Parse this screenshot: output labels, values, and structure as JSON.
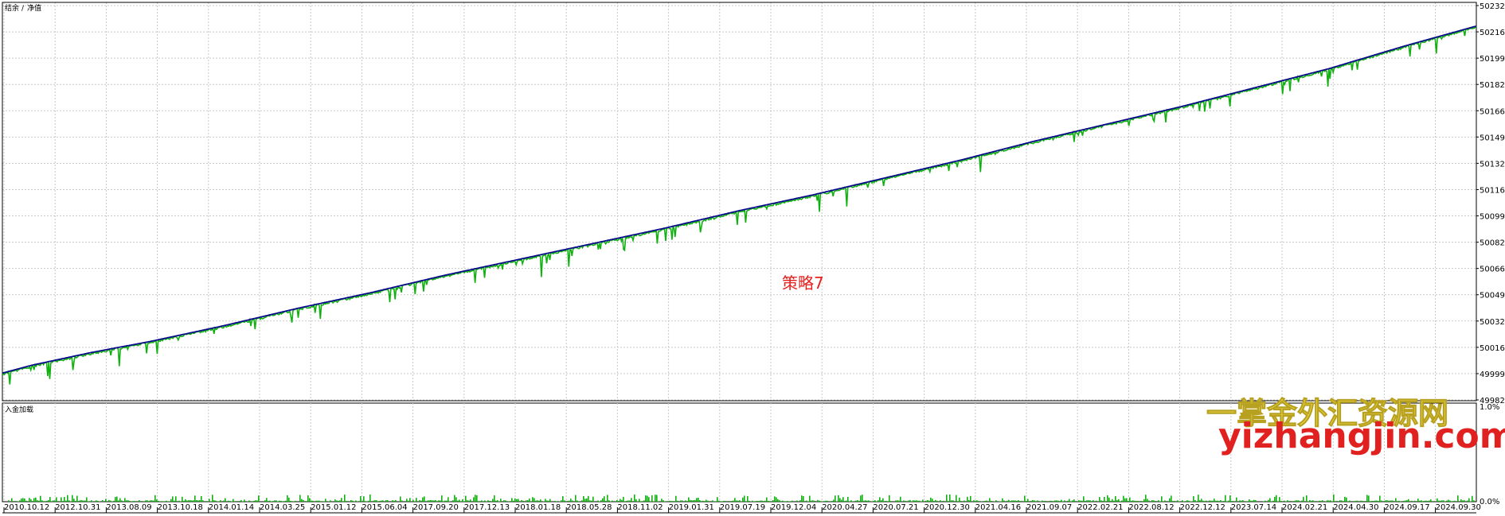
{
  "legend": {
    "balance": "结余",
    "separator": "/",
    "equity": "净值"
  },
  "lower_panel_label": "入金加载",
  "annotation": "策略7",
  "watermark": {
    "title": "一掌金外汇资源网",
    "url": "yizhangjin.com"
  },
  "colors": {
    "balance": "#0a0a8c",
    "equity": "#10b010",
    "deposit_load": "#10b010",
    "grid": "#c8c8c8",
    "annotation": "#e8201e",
    "watermark_title": "#f0e24a",
    "watermark_url": "#e0211f"
  },
  "chart_data": {
    "type": "line",
    "y_ticks": [
      "50232",
      "50216",
      "50199",
      "50182",
      "50166",
      "50149",
      "50132",
      "50116",
      "50099",
      "50082",
      "50066",
      "50049",
      "50032",
      "50016",
      "49999",
      "49982"
    ],
    "ylim": [
      49982,
      50232
    ],
    "x_ticks": [
      "2010.10.12",
      "2012.10.31",
      "2013.08.09",
      "2013.10.18",
      "2014.01.14",
      "2014.03.25",
      "2015.01.12",
      "2015.06.04",
      "2017.09.20",
      "2017.12.13",
      "2018.01.18",
      "2018.05.28",
      "2018.11.02",
      "2019.01.31",
      "2019.07.19",
      "2019.12.04",
      "2020.04.27",
      "2020.07.21",
      "2020.12.30",
      "2021.04.16",
      "2021.09.07",
      "2022.02.21",
      "2022.08.12",
      "2022.12.12",
      "2023.07.14",
      "2024.02.21",
      "2024.04.30",
      "2024.09.17",
      "2024.09.30"
    ],
    "series": [
      {
        "name": "结余",
        "x": [
          0,
          0.02,
          0.04,
          0.06,
          0.1,
          0.15,
          0.2,
          0.25,
          0.3,
          0.35,
          0.4,
          0.45,
          0.5,
          0.55,
          0.6,
          0.65,
          0.7,
          0.75,
          0.8,
          0.85,
          0.9,
          0.95,
          1.0
        ],
        "values": [
          49999,
          50004,
          50008,
          50012,
          50019,
          50029,
          50040,
          50050,
          50061,
          50071,
          50081,
          50091,
          50102,
          50112,
          50123,
          50134,
          50146,
          50157,
          50168,
          50180,
          50192,
          50206,
          50219
        ]
      },
      {
        "name": "净值",
        "x": [
          0.0,
          0.01,
          0.03,
          0.06,
          0.11,
          0.13,
          0.17,
          0.27,
          0.32,
          0.34,
          0.44,
          0.5,
          0.57,
          0.59,
          0.62,
          0.68,
          0.74,
          0.79,
          0.86,
          0.94,
          0.955,
          0.965,
          1.0
        ],
        "values": [
          49999,
          49994,
          49996,
          50006,
          50004,
          49995,
          50018,
          50037,
          50042,
          50052,
          50086,
          50102,
          50118,
          50107,
          50132,
          50142,
          50141,
          50168,
          50167,
          50191,
          50197,
          50195,
          50219
        ]
      }
    ],
    "lower_panel": {
      "y_ticks": [
        "1.0%",
        "0.0%"
      ],
      "ylim": [
        0,
        1
      ]
    }
  }
}
